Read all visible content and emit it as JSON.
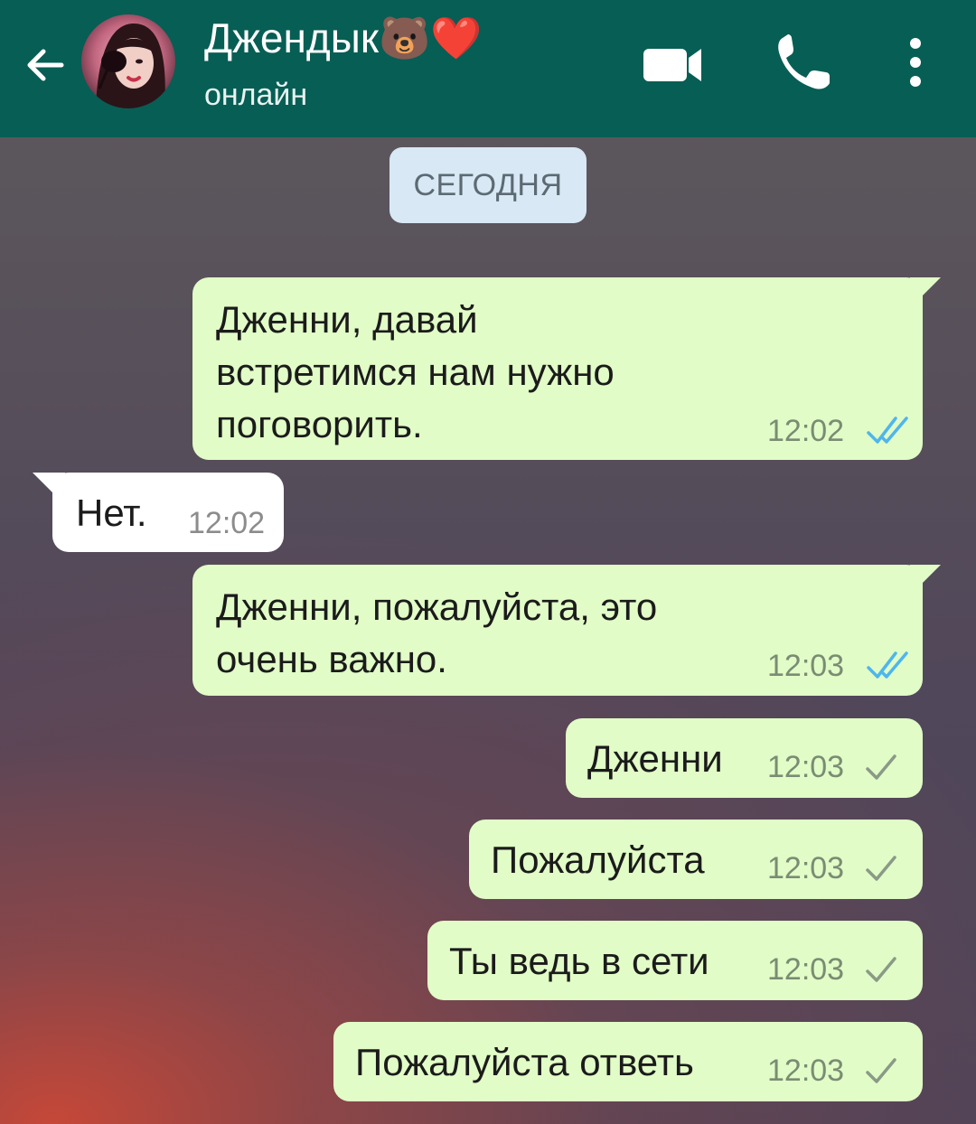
{
  "header": {
    "contact_name": "Джендык🐻❤️",
    "status": "онлайн",
    "colors": {
      "bar": "#075e54",
      "icons": "#ffffff"
    },
    "icons": [
      "back-arrow-icon",
      "video-call-icon",
      "phone-icon",
      "more-vert-icon"
    ]
  },
  "date_chip": "СЕГОДНЯ",
  "messages": [
    {
      "dir": "out",
      "text": "Дженни, давай\nвстретимся нам нужно\nпоговорить.",
      "time": "12:02",
      "status": "read"
    },
    {
      "dir": "in",
      "text": "Нет.",
      "time": "12:02"
    },
    {
      "dir": "out",
      "text": "Дженни, пожалуйста, это\nочень важно.",
      "time": "12:03",
      "status": "read"
    },
    {
      "dir": "out",
      "text": "Дженни",
      "time": "12:03",
      "status": "sent"
    },
    {
      "dir": "out",
      "text": "Пожалуйста",
      "time": "12:03",
      "status": "sent"
    },
    {
      "dir": "out",
      "text": "Ты ведь в сети",
      "time": "12:03",
      "status": "sent"
    },
    {
      "dir": "out",
      "text": "Пожалуйста ответь",
      "time": "12:03",
      "status": "sent"
    }
  ],
  "colors": {
    "outgoing_bubble": "#e1fcc7",
    "incoming_bubble": "#ffffff",
    "read_tick": "#4fb6ec",
    "sent_tick": "#8a9a86"
  }
}
